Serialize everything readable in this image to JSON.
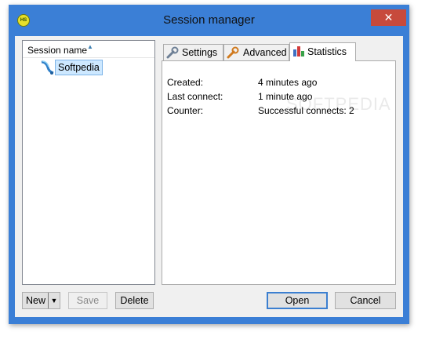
{
  "window": {
    "title": "Session manager",
    "app_icon_text": "HS",
    "close_symbol": "✕",
    "accent_color": "#3b7fd6"
  },
  "tree": {
    "column_header": "Session name",
    "sort_icon": "sort-ascending-icon",
    "items": [
      {
        "label": "Softpedia",
        "icon": "session-icon",
        "selected": true
      }
    ]
  },
  "tabs": [
    {
      "label": "Settings",
      "icon": "wrench-icon",
      "active": false
    },
    {
      "label": "Advanced",
      "icon": "wrench-orange-icon",
      "active": false
    },
    {
      "label": "Statistics",
      "icon": "bar-chart-icon",
      "active": true
    }
  ],
  "statistics": [
    {
      "label": "Created:",
      "value": "4 minutes ago"
    },
    {
      "label": "Last connect:",
      "value": "1 minute ago"
    },
    {
      "label": "Counter:",
      "value": "Successful connects: 2"
    }
  ],
  "buttons": {
    "new": "New",
    "save": "Save",
    "delete": "Delete",
    "open": "Open",
    "cancel": "Cancel"
  }
}
